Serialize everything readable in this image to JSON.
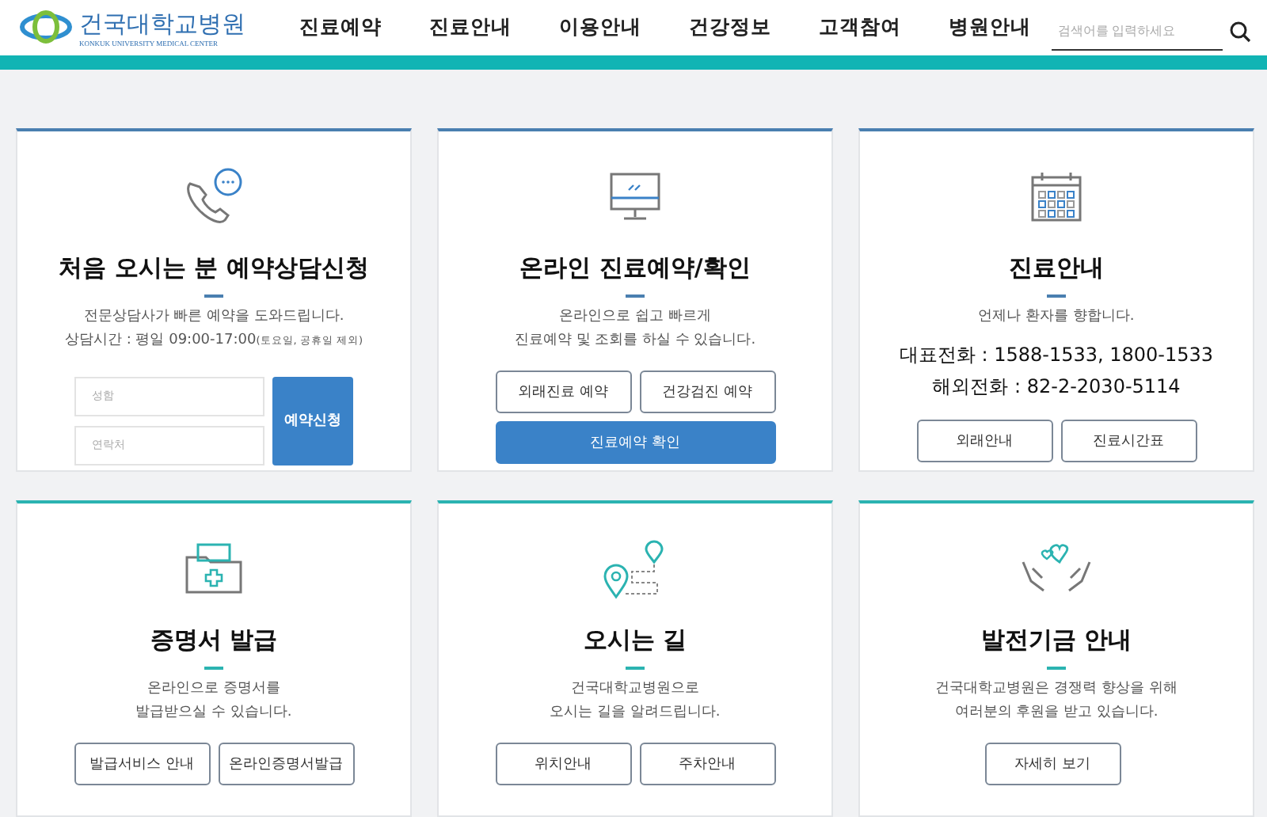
{
  "header": {
    "logo": {
      "name": "건국대학교병원",
      "subtitle": "KONKUK UNIVERSITY MEDICAL CENTER"
    },
    "nav": [
      "진료예약",
      "진료안내",
      "이용안내",
      "건강정보",
      "고객참여",
      "병원안내"
    ],
    "search": {
      "placeholder": "검색어를 입력하세요"
    }
  },
  "cards": [
    {
      "kind": "form",
      "color": "#4a7fb0",
      "title": "처음 오시는 분 예약상담신청",
      "lines": [
        "전문상담사가 빠른 예약을 도와드립니다."
      ],
      "hours": {
        "label": "상담시간 : 평일 09:00-17:00",
        "note": "(토요일, 공휴일 제외)"
      },
      "fields": [
        {
          "placeholder": "성함"
        },
        {
          "placeholder": "연락처"
        }
      ],
      "submit": "예약신청"
    },
    {
      "kind": "buttons",
      "color": "#4a7fb0",
      "title": "온라인 진료예약/확인",
      "lines": [
        "온라인으로 쉽고 빠르게",
        "진료예약 및 조회를 하실 수 있습니다."
      ],
      "buttons": [
        {
          "label": "외래진료 예약",
          "primary": false
        },
        {
          "label": "건강검진 예약",
          "primary": false
        },
        {
          "label": "진료예약 확인",
          "primary": true
        }
      ]
    },
    {
      "kind": "phones",
      "color": "#4a7fb0",
      "title": "진료안내",
      "lines": [
        "언제나 환자를 향합니다."
      ],
      "phones": [
        "대표전화 : 1588-1533, 1800-1533",
        "해외전화 : 82-2-2030-5114"
      ],
      "buttons": [
        {
          "label": "외래안내",
          "primary": false
        },
        {
          "label": "진료시간표",
          "primary": false
        }
      ]
    },
    {
      "kind": "buttons",
      "color": "#2bb3b1",
      "title": "증명서 발급",
      "lines": [
        "온라인으로 증명서를",
        "발급받으실 수 있습니다."
      ],
      "buttons": [
        {
          "label": "발급서비스 안내",
          "primary": false
        },
        {
          "label": "온라인증명서발급",
          "primary": false
        }
      ]
    },
    {
      "kind": "buttons",
      "color": "#2bb3b1",
      "title": "오시는 길",
      "lines": [
        "건국대학교병원으로",
        "오시는 길을 알려드립니다."
      ],
      "buttons": [
        {
          "label": "위치안내",
          "primary": false
        },
        {
          "label": "주차안내",
          "primary": false
        }
      ]
    },
    {
      "kind": "buttons",
      "color": "#2bb3b1",
      "title": "발전기금 안내",
      "lines": [
        "건국대학교병원은 경쟁력 향상을 위해",
        "여러분의 후원을 받고 있습니다."
      ],
      "buttons": [
        {
          "label": "자세히 보기",
          "primary": false
        }
      ]
    }
  ]
}
